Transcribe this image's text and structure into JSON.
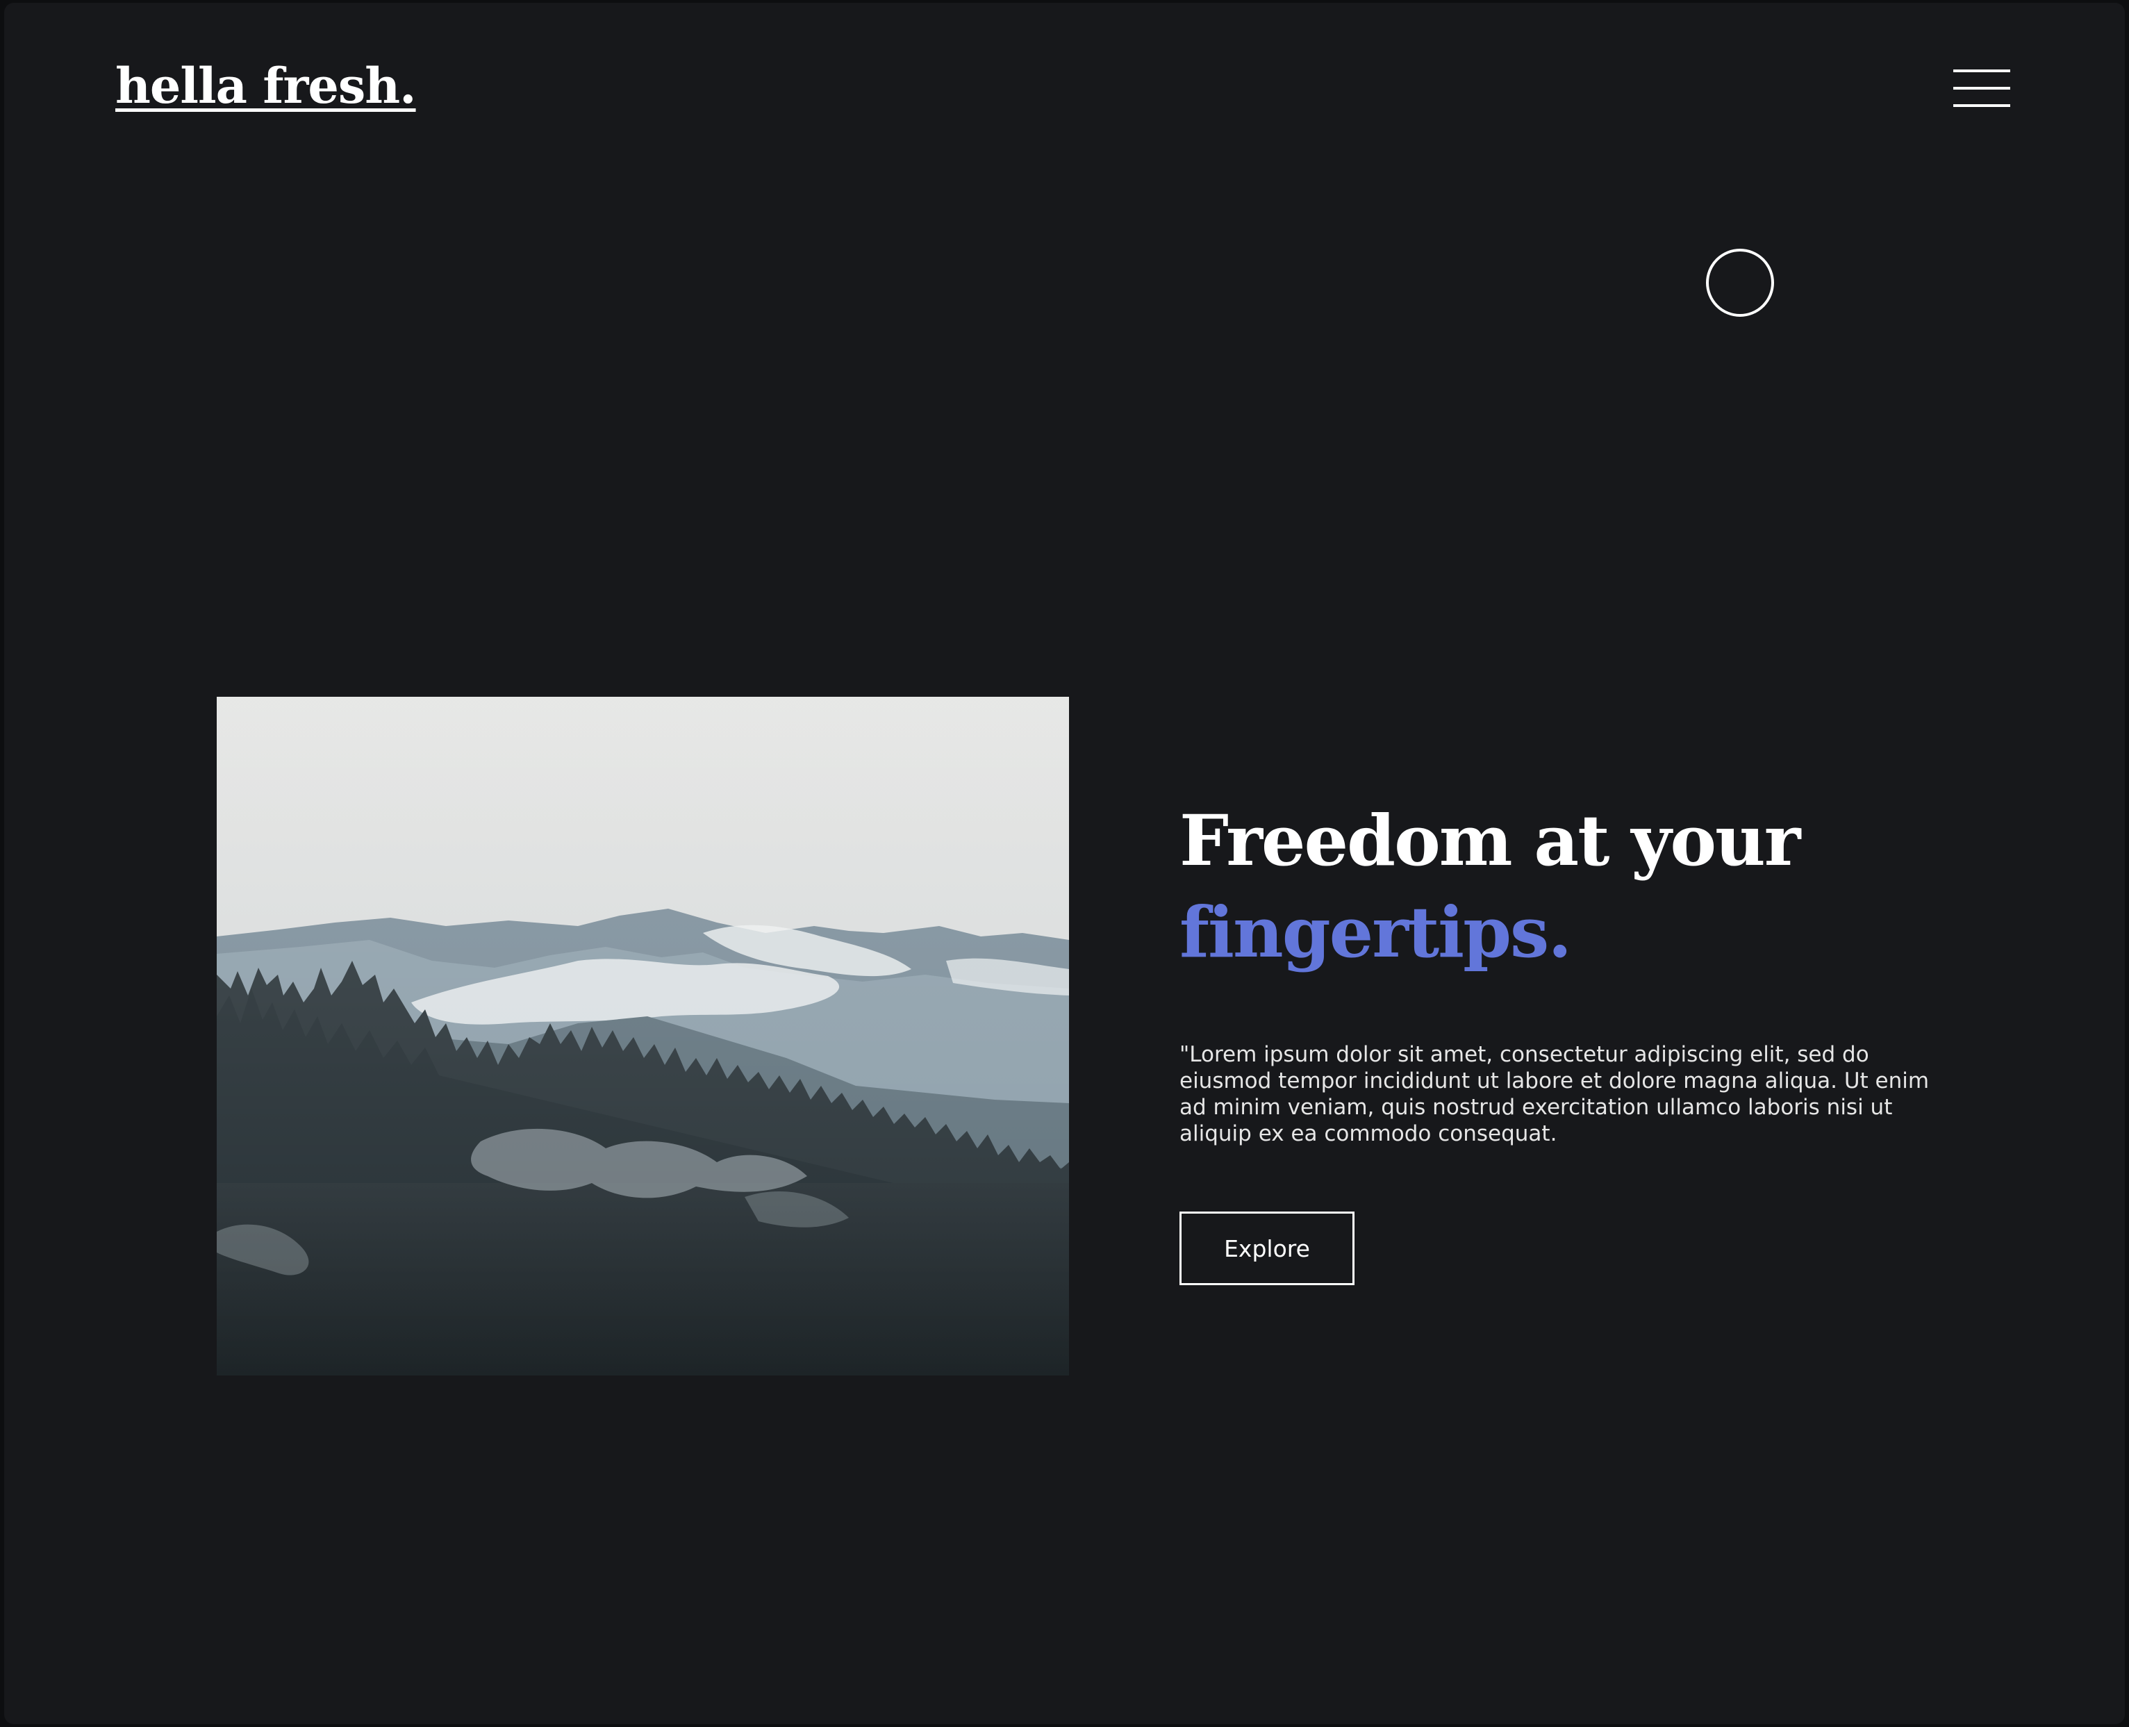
{
  "header": {
    "logo_text": "hella fresh.",
    "menu_icon": "hamburger-menu-icon"
  },
  "cursor": {
    "icon": "circle-cursor-icon"
  },
  "hero": {
    "image_subject": "misty-forest-mountains-photo",
    "headline_line1": "Freedom at your",
    "headline_line2": "fingertips.",
    "body": "\"Lorem ipsum dolor sit amet, consectetur adipiscing elit, sed do eiusmod tempor incididunt ut labore et dolore magna aliqua. Ut enim ad minim veniam, quis nostrud exercitation ullamco laboris nisi ut aliquip ex ea commodo consequat.",
    "cta_label": "Explore"
  },
  "colors": {
    "background": "#17181b",
    "text": "#ffffff",
    "accent": "#6276da"
  }
}
